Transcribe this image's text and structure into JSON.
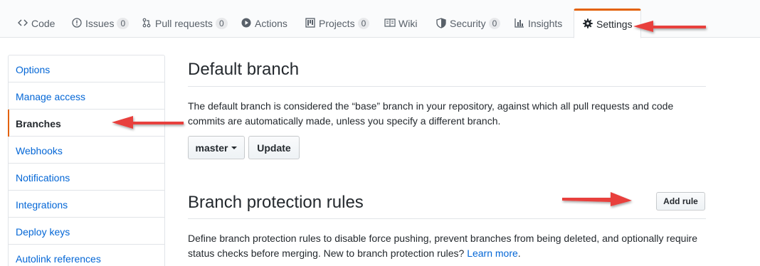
{
  "tabs": [
    {
      "id": "code",
      "label": "Code",
      "icon": "code-icon",
      "counter": null,
      "selected": false
    },
    {
      "id": "issues",
      "label": "Issues",
      "icon": "issue-icon",
      "counter": "0",
      "selected": false
    },
    {
      "id": "pulls",
      "label": "Pull requests",
      "icon": "pull-request-icon",
      "counter": "0",
      "selected": false
    },
    {
      "id": "actions",
      "label": "Actions",
      "icon": "play-icon",
      "counter": null,
      "selected": false
    },
    {
      "id": "projects",
      "label": "Projects",
      "icon": "project-icon",
      "counter": "0",
      "selected": false
    },
    {
      "id": "wiki",
      "label": "Wiki",
      "icon": "book-icon",
      "counter": null,
      "selected": false
    },
    {
      "id": "security",
      "label": "Security",
      "icon": "shield-icon",
      "counter": "0",
      "selected": false
    },
    {
      "id": "insights",
      "label": "Insights",
      "icon": "graph-icon",
      "counter": null,
      "selected": false
    },
    {
      "id": "settings",
      "label": "Settings",
      "icon": "gear-icon",
      "counter": null,
      "selected": true
    }
  ],
  "sidebar": {
    "items": [
      {
        "label": "Options",
        "selected": false
      },
      {
        "label": "Manage access",
        "selected": false
      },
      {
        "label": "Branches",
        "selected": true
      },
      {
        "label": "Webhooks",
        "selected": false
      },
      {
        "label": "Notifications",
        "selected": false
      },
      {
        "label": "Integrations",
        "selected": false
      },
      {
        "label": "Deploy keys",
        "selected": false
      },
      {
        "label": "Autolink references",
        "selected": false
      }
    ]
  },
  "default_branch": {
    "title": "Default branch",
    "description_line1": "The default branch is considered the “base” branch in your repository, against which all pull requests and code",
    "description_line2": "commits are automatically made, unless you specify a different branch.",
    "branch_select": "master",
    "update_button": "Update"
  },
  "protection": {
    "title": "Branch protection rules",
    "add_rule_button": "Add rule",
    "description_line1": "Define branch protection rules to disable force pushing, prevent branches from being deleted, and optionally require",
    "description_line2_prefix": "status checks before merging. New to branch protection rules?",
    "learn_more_link": "Learn more",
    "description_line2_suffix": "."
  },
  "colors": {
    "accent": "#e36209",
    "link": "#0366d6",
    "annotation_arrow": "#e8413d"
  }
}
